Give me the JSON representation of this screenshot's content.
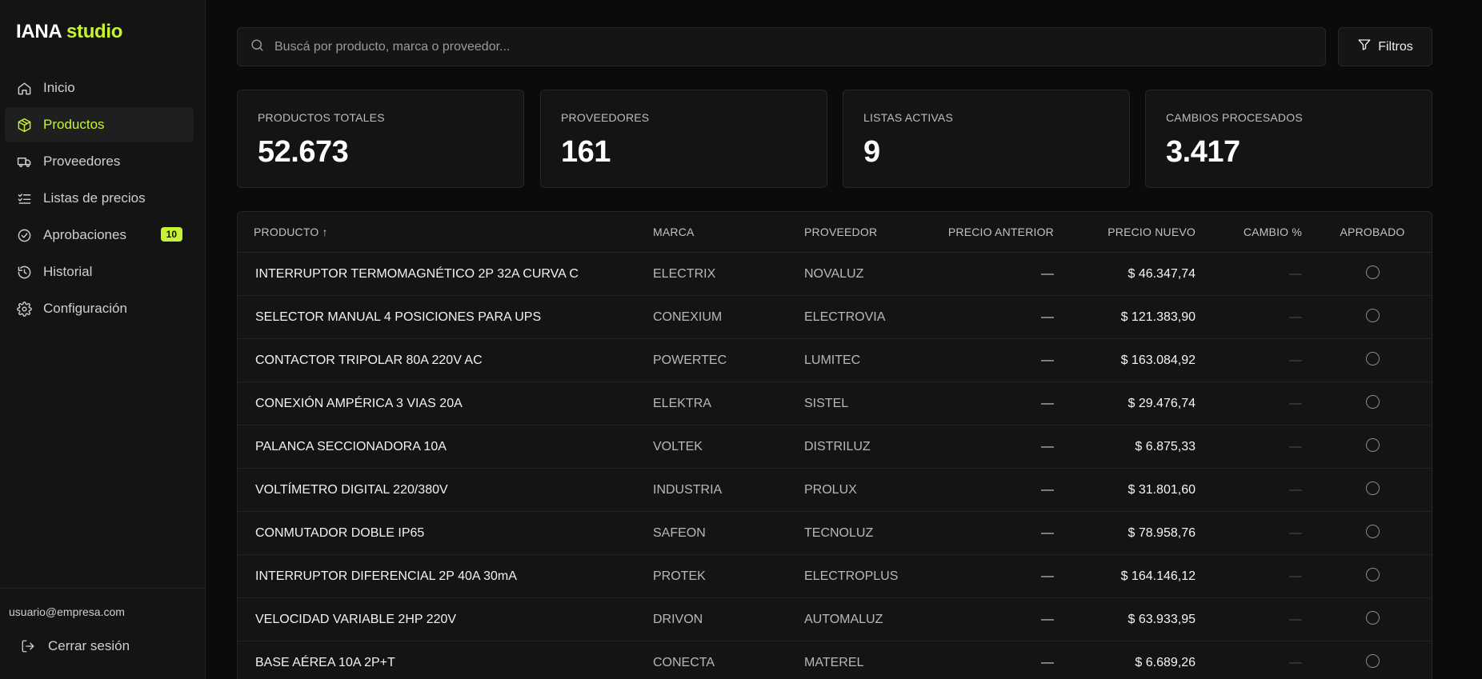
{
  "brand": {
    "name": "IANA",
    "accent": "studio",
    "accent_color": "#c6f432"
  },
  "sidebar": {
    "items": [
      {
        "label": "Inicio",
        "icon": "home-icon"
      },
      {
        "label": "Productos",
        "icon": "package-icon",
        "active": true
      },
      {
        "label": "Proveedores",
        "icon": "truck-icon"
      },
      {
        "label": "Listas de precios",
        "icon": "list-check-icon"
      },
      {
        "label": "Aprobaciones",
        "icon": "check-circle-icon",
        "badge": "10"
      },
      {
        "label": "Historial",
        "icon": "history-icon"
      },
      {
        "label": "Configuración",
        "icon": "gear-icon"
      }
    ],
    "user_email": "usuario@empresa.com",
    "logout_label": "Cerrar sesión"
  },
  "search": {
    "placeholder": "Buscá por producto, marca o proveedor...",
    "value": ""
  },
  "filters_label": "Filtros",
  "stats": [
    {
      "label": "PRODUCTOS TOTALES",
      "value": "52.673"
    },
    {
      "label": "PROVEEDORES",
      "value": "161"
    },
    {
      "label": "LISTAS ACTIVAS",
      "value": "9"
    },
    {
      "label": "CAMBIOS PROCESADOS",
      "value": "3.417"
    }
  ],
  "table": {
    "headers": {
      "producto": "PRODUCTO ↑",
      "marca": "MARCA",
      "proveedor": "PROVEEDOR",
      "precio_anterior": "PRECIO ANTERIOR",
      "precio_nuevo": "PRECIO NUEVO",
      "cambio": "CAMBIO %",
      "aprobado": "APROBADO"
    },
    "rows": [
      {
        "producto": "INTERRUPTOR TERMOMAGNÉTICO 2P 32A CURVA C",
        "marca": "ELECTRIX",
        "proveedor": "NOVALUZ",
        "precio_anterior": "—",
        "precio_nuevo": "$ 46.347,74",
        "cambio": "—"
      },
      {
        "producto": "SELECTOR MANUAL 4 POSICIONES PARA UPS",
        "marca": "CONEXIUM",
        "proveedor": "ELECTROVIA",
        "precio_anterior": "—",
        "precio_nuevo": "$ 121.383,90",
        "cambio": "—"
      },
      {
        "producto": "CONTACTOR TRIPOLAR 80A 220V AC",
        "marca": "POWERTEC",
        "proveedor": "LUMITEC",
        "precio_anterior": "—",
        "precio_nuevo": "$ 163.084,92",
        "cambio": "—"
      },
      {
        "producto": "CONEXIÓN AMPÉRICA 3 VIAS 20A",
        "marca": "ELEKTRA",
        "proveedor": "SISTEL",
        "precio_anterior": "—",
        "precio_nuevo": "$ 29.476,74",
        "cambio": "—"
      },
      {
        "producto": "PALANCA SECCIONADORA 10A",
        "marca": "VOLTEK",
        "proveedor": "DISTRILUZ",
        "precio_anterior": "—",
        "precio_nuevo": "$ 6.875,33",
        "cambio": "—"
      },
      {
        "producto": "VOLTÍMETRO DIGITAL 220/380V",
        "marca": "INDUSTRIA",
        "proveedor": "PROLUX",
        "precio_anterior": "—",
        "precio_nuevo": "$ 31.801,60",
        "cambio": "—"
      },
      {
        "producto": "CONMUTADOR DOBLE IP65",
        "marca": "SAFEON",
        "proveedor": "TECNOLUZ",
        "precio_anterior": "—",
        "precio_nuevo": "$ 78.958,76",
        "cambio": "—"
      },
      {
        "producto": "INTERRUPTOR DIFERENCIAL 2P 40A 30mA",
        "marca": "PROTEK",
        "proveedor": "ELECTROPLUS",
        "precio_anterior": "—",
        "precio_nuevo": "$ 164.146,12",
        "cambio": "—"
      },
      {
        "producto": "VELOCIDAD VARIABLE 2HP 220V",
        "marca": "DRIVON",
        "proveedor": "AUTOMALUZ",
        "precio_anterior": "—",
        "precio_nuevo": "$ 63.933,95",
        "cambio": "—"
      },
      {
        "producto": "BASE AÉREA 10A 2P+T",
        "marca": "CONECTA",
        "proveedor": "MATEREL",
        "precio_anterior": "—",
        "precio_nuevo": "$ 6.689,26",
        "cambio": "—"
      }
    ]
  }
}
